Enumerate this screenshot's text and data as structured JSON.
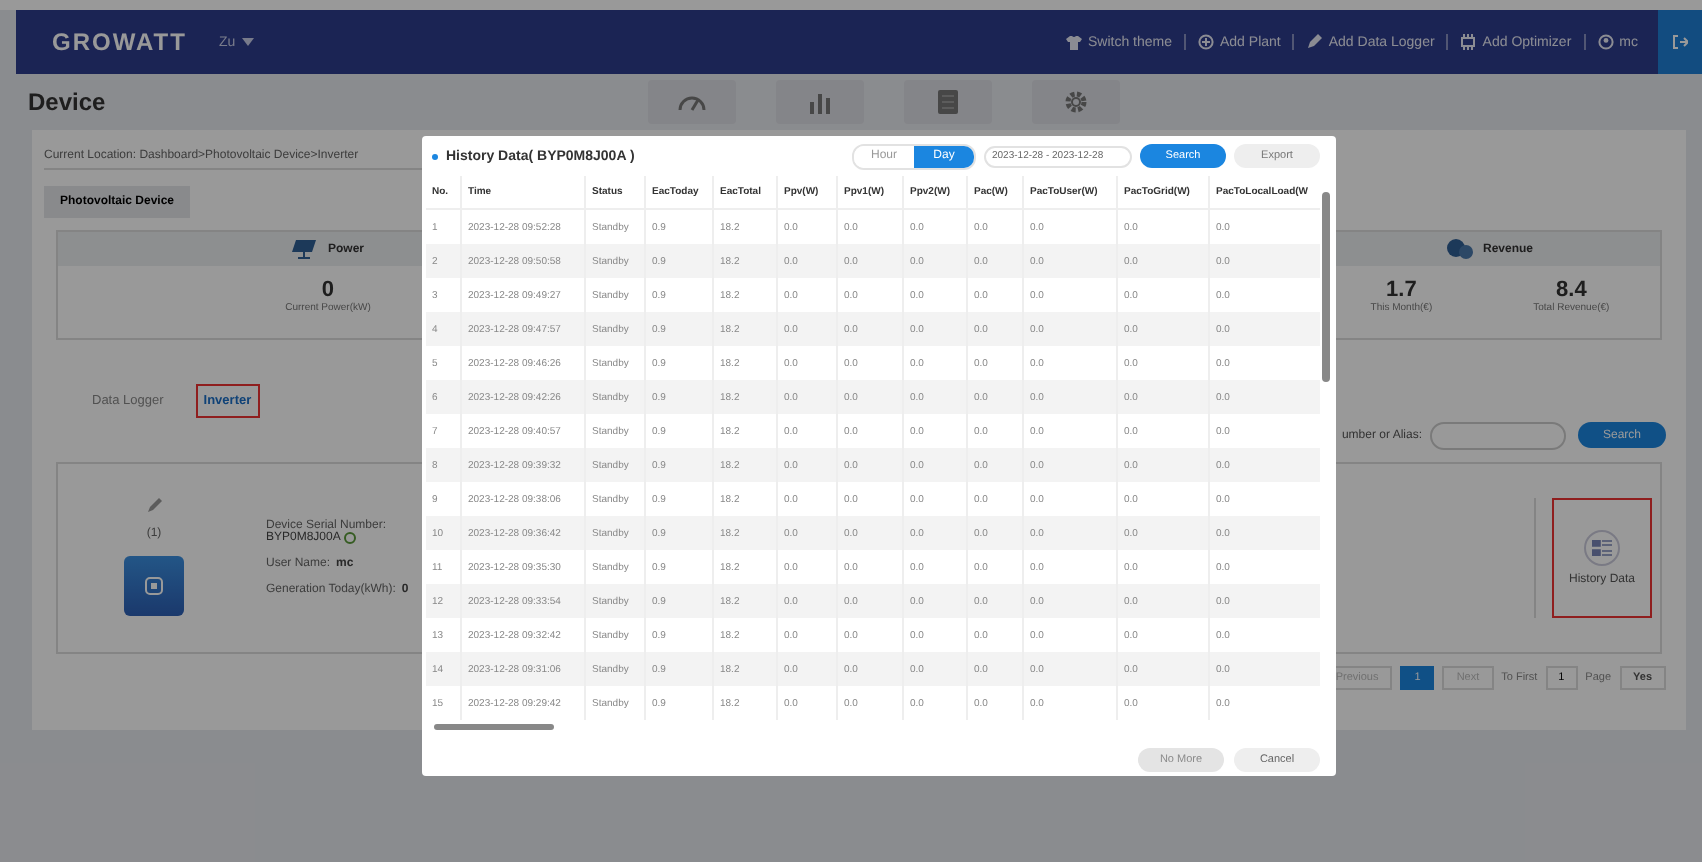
{
  "header": {
    "logo": "GROWATT",
    "plant": "Zu",
    "actions": [
      {
        "label": "Switch theme",
        "kind": "shirt"
      },
      {
        "label": "Add Plant",
        "kind": "plus"
      },
      {
        "label": "Add Data Logger",
        "kind": "pen"
      },
      {
        "label": "Add Optimizer",
        "kind": "chip"
      }
    ],
    "user": "mc"
  },
  "page": {
    "title": "Device",
    "breadcrumb": "Current Location: Dashboard>Photovoltaic Device>Inverter",
    "device_tab": "Photovoltaic Device"
  },
  "summary": {
    "sections": [
      {
        "title": "Power",
        "kind": "power",
        "stats": [
          {
            "value": "0",
            "label": "Current Power(kW)"
          }
        ]
      },
      {
        "title": "Revenue",
        "kind": "revenue",
        "stats": [
          {
            "value": "1.7",
            "label": "This Month(€)"
          },
          {
            "value": "8.4",
            "label": "Total Revenue(€)"
          }
        ]
      }
    ]
  },
  "device_types": [
    {
      "label": "Data Logger",
      "selected": false
    },
    {
      "label": "Inverter",
      "selected": true
    }
  ],
  "search": {
    "label": "umber or Alias:",
    "button": "Search"
  },
  "device_card": {
    "index": "(1)",
    "serial_label": "Device Serial Number:",
    "serial": "BYP0M8J00A",
    "user_label": "User Name:",
    "user": "mc",
    "generation_label": "Generation Today(kWh):",
    "generation": "0",
    "action": "History Data"
  },
  "pagination": {
    "previous": "Previous",
    "pages": [
      {
        "label": "1",
        "selected": true
      }
    ],
    "next": "Next",
    "to_first": "To First",
    "page_input": "1",
    "page_label": "Page",
    "go": "Yes"
  },
  "dialog": {
    "title": "History Data( BYP0M8J00A )",
    "ranges": [
      {
        "label": "Hour",
        "selected": false
      },
      {
        "label": "Day",
        "selected": true
      }
    ],
    "date_range": "2023-12-28 - 2023-12-28",
    "search": "Search",
    "export": "Export",
    "columns": [
      "No.",
      "Time",
      "Status",
      "EacToday",
      "EacTotal",
      "Ppv(W)",
      "Ppv1(W)",
      "Ppv2(W)",
      "Pac(W)",
      "PacToUser(W)",
      "PacToGrid(W)",
      "PacToLocalLoad(W"
    ],
    "rows": [
      [
        "1",
        "2023-12-28 09:52:28",
        "Standby",
        "0.9",
        "18.2",
        "0.0",
        "0.0",
        "0.0",
        "0.0",
        "0.0",
        "0.0",
        "0.0"
      ],
      [
        "2",
        "2023-12-28 09:50:58",
        "Standby",
        "0.9",
        "18.2",
        "0.0",
        "0.0",
        "0.0",
        "0.0",
        "0.0",
        "0.0",
        "0.0"
      ],
      [
        "3",
        "2023-12-28 09:49:27",
        "Standby",
        "0.9",
        "18.2",
        "0.0",
        "0.0",
        "0.0",
        "0.0",
        "0.0",
        "0.0",
        "0.0"
      ],
      [
        "4",
        "2023-12-28 09:47:57",
        "Standby",
        "0.9",
        "18.2",
        "0.0",
        "0.0",
        "0.0",
        "0.0",
        "0.0",
        "0.0",
        "0.0"
      ],
      [
        "5",
        "2023-12-28 09:46:26",
        "Standby",
        "0.9",
        "18.2",
        "0.0",
        "0.0",
        "0.0",
        "0.0",
        "0.0",
        "0.0",
        "0.0"
      ],
      [
        "6",
        "2023-12-28 09:42:26",
        "Standby",
        "0.9",
        "18.2",
        "0.0",
        "0.0",
        "0.0",
        "0.0",
        "0.0",
        "0.0",
        "0.0"
      ],
      [
        "7",
        "2023-12-28 09:40:57",
        "Standby",
        "0.9",
        "18.2",
        "0.0",
        "0.0",
        "0.0",
        "0.0",
        "0.0",
        "0.0",
        "0.0"
      ],
      [
        "8",
        "2023-12-28 09:39:32",
        "Standby",
        "0.9",
        "18.2",
        "0.0",
        "0.0",
        "0.0",
        "0.0",
        "0.0",
        "0.0",
        "0.0"
      ],
      [
        "9",
        "2023-12-28 09:38:06",
        "Standby",
        "0.9",
        "18.2",
        "0.0",
        "0.0",
        "0.0",
        "0.0",
        "0.0",
        "0.0",
        "0.0"
      ],
      [
        "10",
        "2023-12-28 09:36:42",
        "Standby",
        "0.9",
        "18.2",
        "0.0",
        "0.0",
        "0.0",
        "0.0",
        "0.0",
        "0.0",
        "0.0"
      ],
      [
        "11",
        "2023-12-28 09:35:30",
        "Standby",
        "0.9",
        "18.2",
        "0.0",
        "0.0",
        "0.0",
        "0.0",
        "0.0",
        "0.0",
        "0.0"
      ],
      [
        "12",
        "2023-12-28 09:33:54",
        "Standby",
        "0.9",
        "18.2",
        "0.0",
        "0.0",
        "0.0",
        "0.0",
        "0.0",
        "0.0",
        "0.0"
      ],
      [
        "13",
        "2023-12-28 09:32:42",
        "Standby",
        "0.9",
        "18.2",
        "0.0",
        "0.0",
        "0.0",
        "0.0",
        "0.0",
        "0.0",
        "0.0"
      ],
      [
        "14",
        "2023-12-28 09:31:06",
        "Standby",
        "0.9",
        "18.2",
        "0.0",
        "0.0",
        "0.0",
        "0.0",
        "0.0",
        "0.0",
        "0.0"
      ],
      [
        "15",
        "2023-12-28 09:29:42",
        "Standby",
        "0.9",
        "18.2",
        "0.0",
        "0.0",
        "0.0",
        "0.0",
        "0.0",
        "0.0",
        "0.0"
      ]
    ],
    "buttons": [
      {
        "label": "No More",
        "disabled": true
      },
      {
        "label": "Cancel",
        "disabled": false
      }
    ]
  }
}
